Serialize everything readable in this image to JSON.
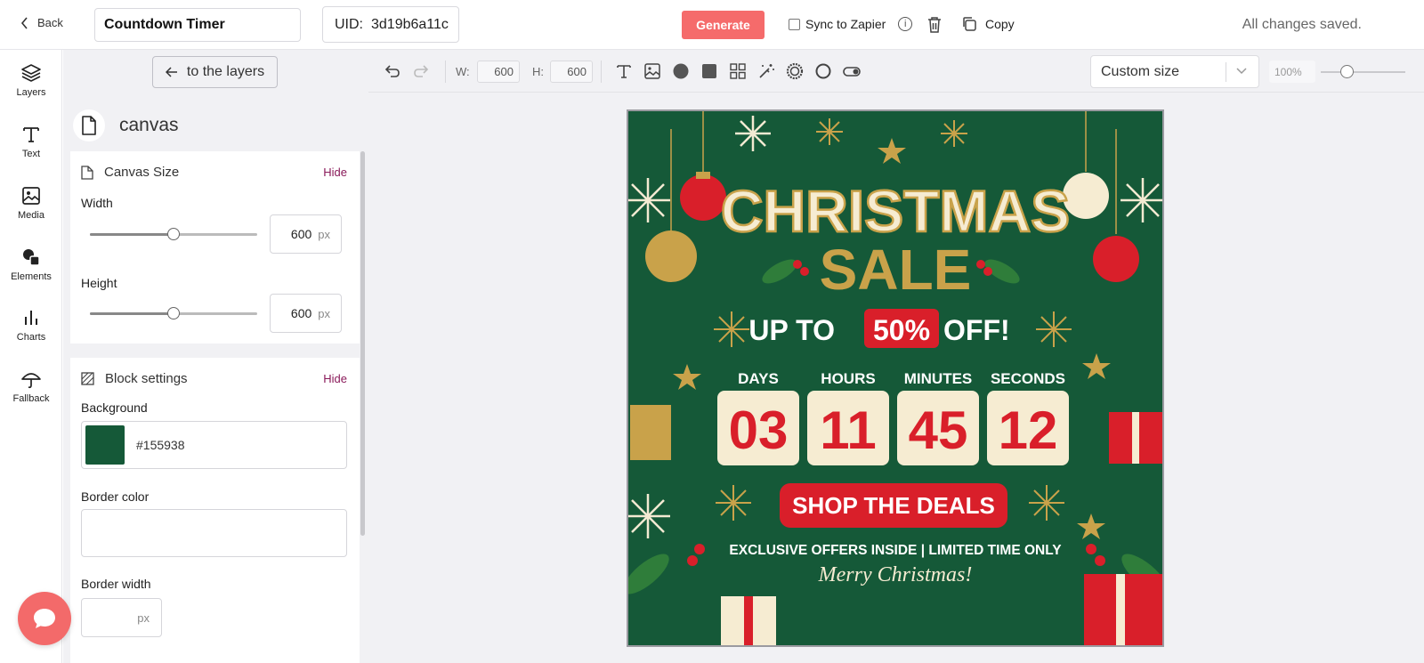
{
  "topbar": {
    "back_label": "Back",
    "title_value": "Countdown Timer",
    "uid_label": "UID:",
    "uid_value": "3d19b6a11c",
    "generate_label": "Generate",
    "sync_label": "Sync to Zapier",
    "copy_label": "Copy",
    "status": "All changes saved."
  },
  "rail": {
    "items": [
      {
        "label": "Layers",
        "icon": "layers-icon"
      },
      {
        "label": "Text",
        "icon": "text-icon"
      },
      {
        "label": "Media",
        "icon": "image-icon"
      },
      {
        "label": "Elements",
        "icon": "shapes-icon"
      },
      {
        "label": "Charts",
        "icon": "bar-chart-icon"
      },
      {
        "label": "Fallback",
        "icon": "umbrella-icon"
      }
    ]
  },
  "panel": {
    "to_layers_label": "to the layers",
    "section_title": "canvas",
    "canvas_size": {
      "title": "Canvas Size",
      "hide_label": "Hide",
      "width_label": "Width",
      "width_value": "600",
      "width_slider": 0.5,
      "height_label": "Height",
      "height_value": "600",
      "height_slider": 0.5,
      "unit": "px"
    },
    "block_settings": {
      "title": "Block settings",
      "hide_label": "Hide",
      "background_label": "Background",
      "background_value": "#155938",
      "border_color_label": "Border color",
      "border_width_label": "Border width",
      "border_width_unit": "px"
    }
  },
  "toolbar": {
    "w_label": "W:",
    "w_value": "600",
    "h_label": "H:",
    "h_value": "600",
    "size_preset": "Custom size",
    "zoom_value": "100%",
    "zoom_slider": 0.3,
    "tools": [
      "text-tool-icon",
      "image-tool-icon",
      "circle-tool-icon",
      "square-tool-icon",
      "grid-tool-icon",
      "magic-wand-icon",
      "ring-tool-icon",
      "circle-outline-icon",
      "toggle-tool-icon"
    ]
  },
  "canvas_content": {
    "headline_1": "CHRISTMAS",
    "headline_2": "SALE",
    "offer_prefix": "UP TO",
    "offer_percent": "50%",
    "offer_suffix": "OFF!",
    "units": [
      "DAYS",
      "HOURS",
      "MINUTES",
      "SECONDS"
    ],
    "values": [
      "03",
      "11",
      "45",
      "12"
    ],
    "cta": "SHOP THE DEALS",
    "tagline": "EXCLUSIVE OFFERS INSIDE | LIMITED TIME ONLY",
    "greeting": "Merry Christmas!"
  },
  "colors": {
    "accent": "#f56b6b",
    "canvas_bg": "#155938",
    "gold": "#c9a24a",
    "red": "#d91f2a",
    "cream": "#f6ecd2",
    "link": "#8a1a5a"
  }
}
